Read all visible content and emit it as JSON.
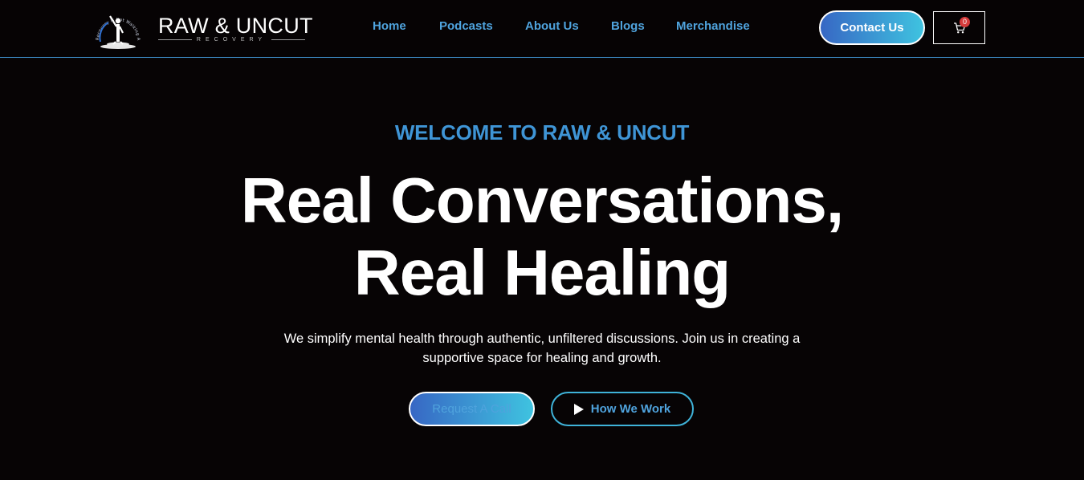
{
  "brand": {
    "name": "RAW & UNCUT",
    "tagline": "RECOVERY",
    "emblem_text": "Recovery is Not Walking Alone"
  },
  "nav": {
    "items": [
      {
        "label": "Home"
      },
      {
        "label": "Podcasts"
      },
      {
        "label": "About Us"
      },
      {
        "label": "Blogs"
      },
      {
        "label": "Merchandise"
      }
    ]
  },
  "header": {
    "contact_label": "Contact Us",
    "cart_count": "0",
    "cart_icon": "cart-icon"
  },
  "hero": {
    "eyebrow": "WELCOME TO RAW & UNCUT",
    "headline_line1": "Real Conversations,",
    "headline_line2": "Real Healing",
    "subtext_line1": "We simplify mental health through authentic, unfiltered discussions. Join us in creating a",
    "subtext_line2": "supportive space for healing and growth.",
    "request_label": "Request A Call",
    "how_label": "How We Work",
    "how_icon": "play-icon"
  },
  "colors": {
    "background": "#070405",
    "accent_blue": "#4fa3dd",
    "gradient_start": "#3767c4",
    "gradient_end": "#3fc3e0",
    "badge_red": "#d63b3b"
  }
}
